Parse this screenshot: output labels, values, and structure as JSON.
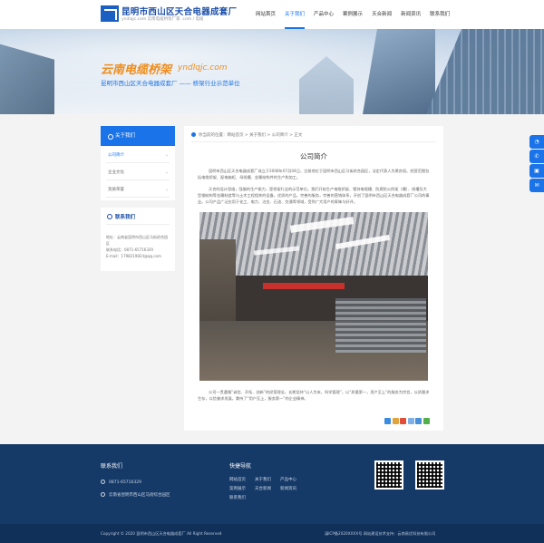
{
  "header": {
    "brand_name": "昆明市西山区天合电器成套厂",
    "brand_sub": "yndlqjc.com 云南电缆桥架厂家 .com / 电缆",
    "nav": [
      "网站首页",
      "关于我们",
      "产品中心",
      "案例展示",
      "天合新闻",
      "新闻资讯",
      "联系我们"
    ],
    "nav_active": "关于我们"
  },
  "banner": {
    "title": "云南电缆桥架",
    "domain": "yndlqjc.com",
    "slogan": "昆明市西山区天合电器成套厂 —— 桥架行业示范单位"
  },
  "sidebar": {
    "head": "关于我们",
    "items": [
      {
        "label": "公司简介",
        "active": true
      },
      {
        "label": "企业文化",
        "active": false
      },
      {
        "label": "资质荣誉",
        "active": false
      }
    ],
    "contact": {
      "title": "联系我们",
      "address": "地址：云南省昆明市西山区马街综合园区",
      "phone": "联系电话：0871-65716329",
      "email": "E-mail：1798219824@qq.com"
    }
  },
  "main": {
    "breadcrumb": "你当前的位置：网站首页 > 关于我们 > 公司简介 > 正文",
    "title": "公司简介",
    "paragraphs": [
      "昆明市西山区天合电器成套厂成立于2008年07月04日，注册地位于昆明市西山区马街综合园区，法定代表人为黄良权。经营范围包括电缆桥架、配电箱柜、母线槽、金属结构件的生产和加工。",
      "天合的设计思维，强服的生产能力，是桥架行业的示范单位。我们开始生产电缆桥架、镀锌电缆槽、防腐防火桥架（槽）、线槽及大型钢结构等金属制造等与土木工程相关的设备。优质的产品，完善的服务，完善的营销体系，开创了昆明市西山区天合电器成套厂公司的事业。公司产品广泛应用于化工、电力、冶金、石油、交通等领域，受到广大用户的青睐与好评。",
      "公司一贯遵循“诚信、开拓、创新”的经营理念，长期坚持“以人为本，科学管理”，以“质量第一，用户至上”的服务为宗旨，以质量求生存，以信誉求发展，秉持了“用户至上，服务第一”的企业精神。"
    ]
  },
  "share_colors": [
    "#3b8be0",
    "#e0a43b",
    "#e24d3b",
    "#7fb1e6",
    "#4a90d9",
    "#52b04a"
  ],
  "float_icons": [
    "qq-icon",
    "phone-icon",
    "wechat-icon",
    "message-icon"
  ],
  "footer": {
    "contact_head": "联系我们",
    "phone": "0871-65716329",
    "address": "云南省昆明市西山区马街综合园区",
    "links_head": "快捷导航",
    "links": [
      "网站首页",
      "关于我们",
      "产品中心",
      "案例展示",
      "天合新闻",
      "新闻资讯",
      "联系我们"
    ],
    "qr_labels": [
      "",
      ""
    ],
    "copyright": "Copyright © 2020 昆明市西山区天合电器成套厂 All Right Reserved",
    "icp": "滇ICP备2020XXXX号   网站建设技术支持：云南易优科技有限公司"
  },
  "colors": {
    "brand_blue": "#1a73e8",
    "footer_bg": "#163a68",
    "banner_orange": "#f08c1c"
  }
}
